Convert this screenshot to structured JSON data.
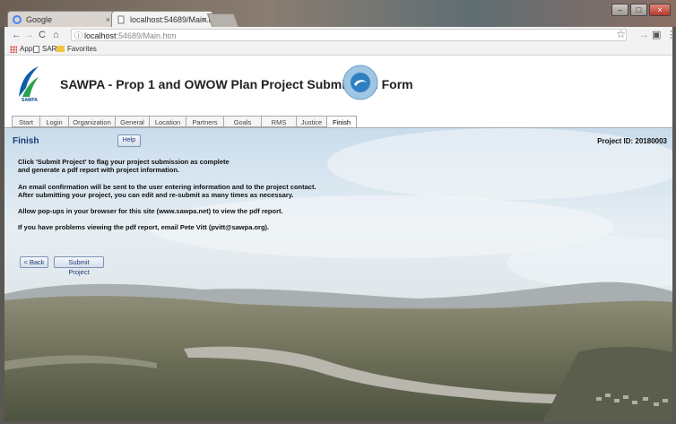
{
  "browser": {
    "tabs": [
      {
        "label": "Google",
        "close": "×"
      },
      {
        "label": "localhost:54689/Main.htm",
        "close": "×"
      }
    ],
    "window_controls": [
      "–",
      "□",
      "×"
    ],
    "address": {
      "host": "localhost",
      "path": ":54689/Main.htm"
    },
    "bookmarks": [
      "Apps",
      "SARI",
      "Favorites"
    ]
  },
  "header": {
    "title": "SAWPA - Prop 1 and OWOW Plan Project Submission Form",
    "logo_text": "SAWPA"
  },
  "nav_tabs": [
    {
      "label": "Start"
    },
    {
      "label": "Login"
    },
    {
      "label": "Organization"
    },
    {
      "label": "General"
    },
    {
      "label": "Location"
    },
    {
      "label": "Partners"
    },
    {
      "label": "Goals"
    },
    {
      "label": "RMS"
    },
    {
      "label": "Justice"
    },
    {
      "label": "Finish"
    }
  ],
  "finish": {
    "title": "Finish",
    "help_label": "Help",
    "project_id": "Project ID: 20180003",
    "messages": [
      "Click 'Submit Project' to flag your project submission as complete",
      "and generate a pdf report with project information.",
      "An email confirmation will be sent to the user entering information and to the project contact.",
      "After submitting your project, you can edit and re-submit as many times as necessary.",
      "Allow pop-ups in your browser for this site (www.sawpa.net) to view the pdf report.",
      "If you have problems viewing the pdf report, email Pete Vitt (pvitt@sawpa.org)."
    ],
    "back_label": "< Back",
    "submit_label": "Submit Project"
  },
  "colors": {
    "accent": "#1c3d73",
    "button_border": "#7e93b5"
  }
}
